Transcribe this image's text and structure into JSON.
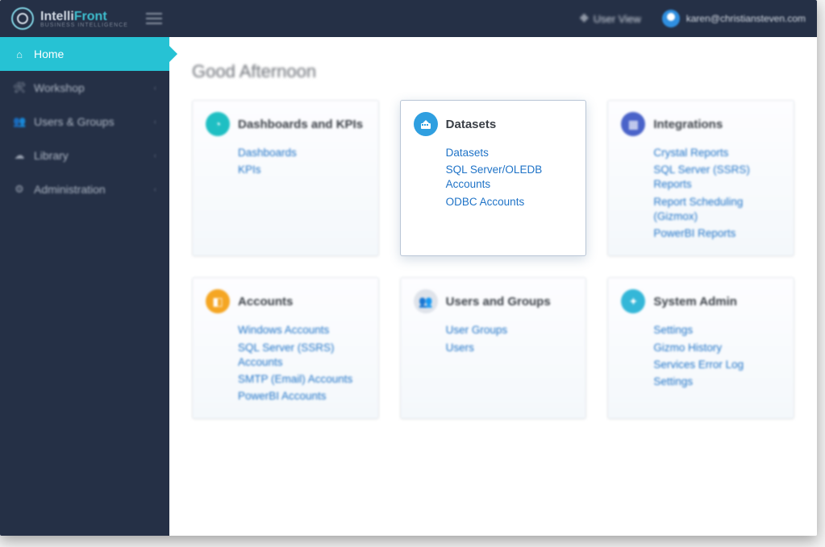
{
  "brand": {
    "name_part1": "Intelli",
    "name_part2": "Front",
    "sub": "BUSINESS INTELLIGENCE"
  },
  "topbar": {
    "user_view_label": "User View",
    "user_email": "karen@christiansteven.com"
  },
  "sidebar": {
    "items": [
      {
        "label": "Home",
        "icon": "home",
        "active": true
      },
      {
        "label": "Workshop",
        "icon": "wrench"
      },
      {
        "label": "Users & Groups",
        "icon": "users"
      },
      {
        "label": "Library",
        "icon": "cloud"
      },
      {
        "label": "Administration",
        "icon": "gear"
      }
    ]
  },
  "main": {
    "greeting": "Good Afternoon",
    "cards": [
      {
        "title": "Dashboards and KPIs",
        "icon_color": "teal",
        "links": [
          "Dashboards",
          "KPIs"
        ]
      },
      {
        "title": "Datasets",
        "icon_color": "blue",
        "focused": true,
        "links": [
          "Datasets",
          "SQL Server/OLEDB Accounts",
          "ODBC Accounts"
        ]
      },
      {
        "title": "Integrations",
        "icon_color": "indigo",
        "links": [
          "Crystal Reports",
          "SQL Server (SSRS) Reports",
          "Report Scheduling (Gizmox)",
          "PowerBI Reports"
        ]
      },
      {
        "title": "Accounts",
        "icon_color": "orange",
        "links": [
          "Windows Accounts",
          "SQL Server (SSRS) Accounts",
          "SMTP (Email) Accounts",
          "PowerBI Accounts"
        ]
      },
      {
        "title": "Users and Groups",
        "icon_color": "grey",
        "links": [
          "User Groups",
          "Users"
        ]
      },
      {
        "title": "System Admin",
        "icon_color": "cyan",
        "links": [
          "Settings",
          "Gizmo History",
          "Services Error Log",
          "Settings"
        ]
      }
    ]
  }
}
